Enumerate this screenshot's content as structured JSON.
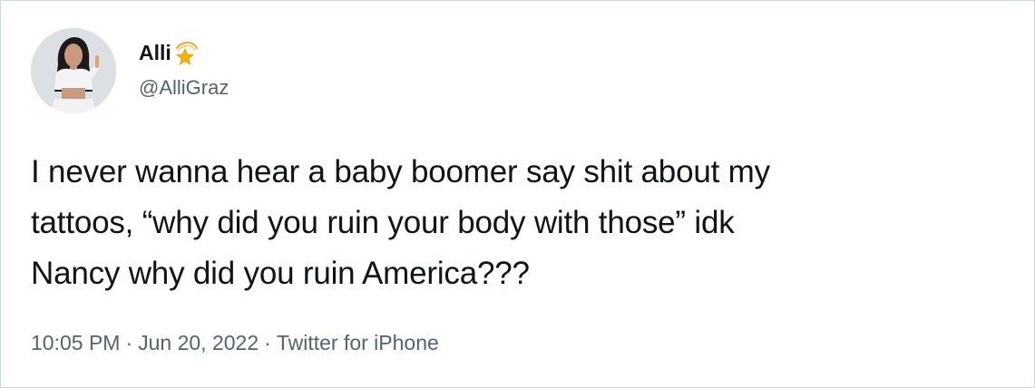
{
  "tweet": {
    "author": {
      "display_name": "Alli",
      "name_emoji": "shooting-star-icon",
      "handle": "@AlliGraz"
    },
    "text_lines": [
      "I never wanna hear a baby boomer say shit about my",
      "tattoos, “why did you ruin your body with those” idk",
      "Nancy why did you ruin America???"
    ],
    "meta": {
      "time": "10:05 PM",
      "separator": "·",
      "date": "Jun 20, 2022",
      "source": "Twitter for iPhone"
    }
  },
  "colors": {
    "text_primary": "#0f1419",
    "text_secondary": "#536471",
    "border": "#cfd9de",
    "star": "#f5b400"
  }
}
